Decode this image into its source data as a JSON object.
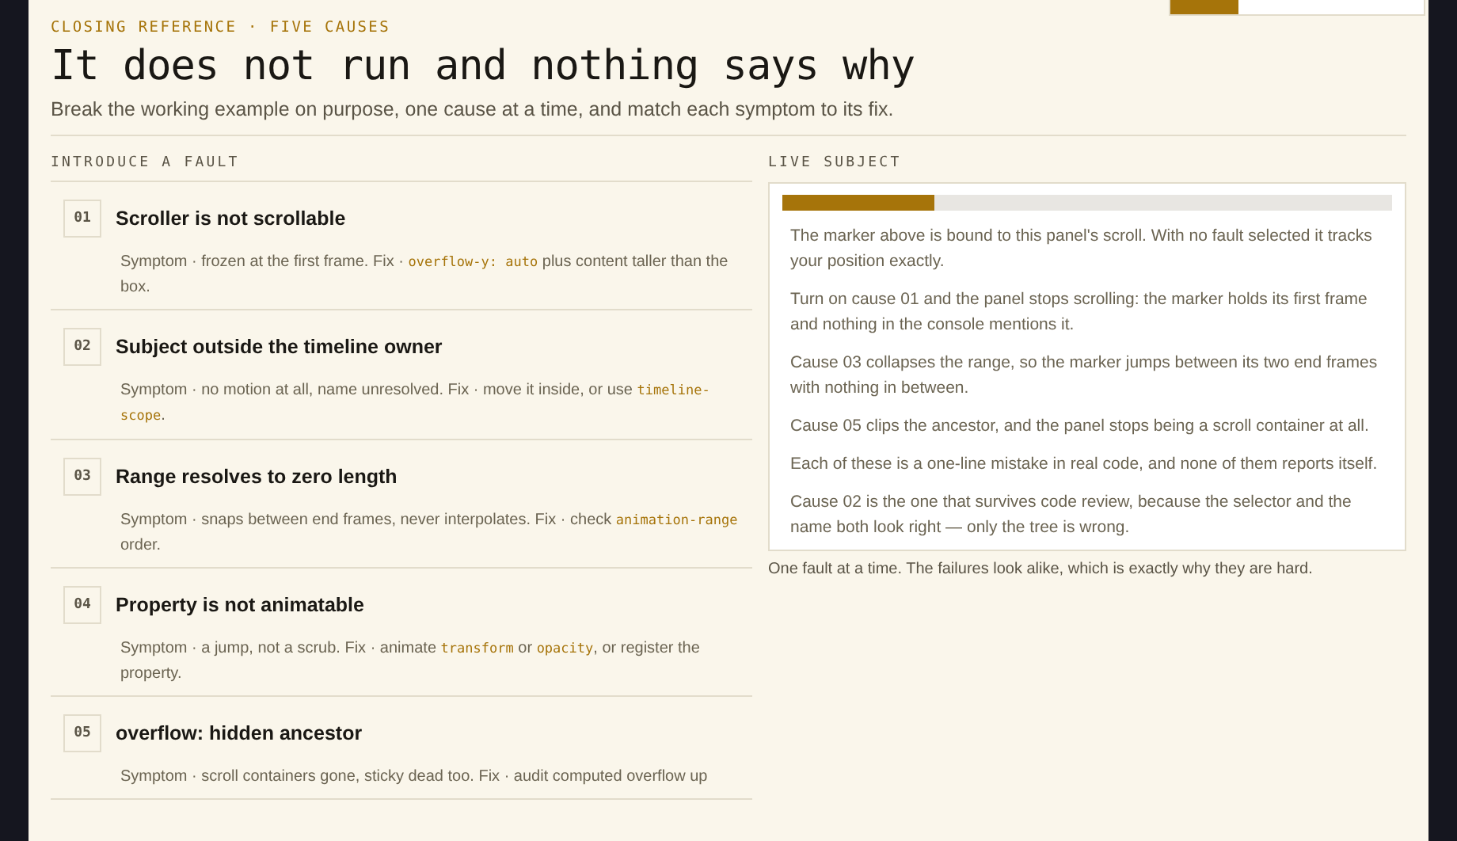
{
  "page_progress": {
    "level": 0.27
  },
  "header": {
    "eyebrow": "CLOSING REFERENCE · FIVE CAUSES",
    "title": "It does not run and nothing says why",
    "lede": "Break the working example on purpose, one cause at a time, and match each symptom to its fix."
  },
  "faults": {
    "heading": "INTRODUCE A FAULT",
    "items": [
      {
        "number": "01",
        "title": "Scroller is not scrollable",
        "body": [
          {
            "kind": "text",
            "text": "Symptom · frozen at the first frame. Fix · "
          },
          {
            "kind": "code",
            "text": "overflow-y: auto"
          },
          {
            "kind": "text",
            "text": " plus content taller than the box."
          }
        ]
      },
      {
        "number": "02",
        "title": "Subject outside the timeline owner",
        "body": [
          {
            "kind": "text",
            "text": "Symptom · no motion at all, name unresolved. Fix · move it inside, or use "
          },
          {
            "kind": "code",
            "text": "timeline-scope"
          },
          {
            "kind": "text",
            "text": "."
          }
        ]
      },
      {
        "number": "03",
        "title": "Range resolves to zero length",
        "body": [
          {
            "kind": "text",
            "text": "Symptom · snaps between end frames, never interpolates. Fix · check "
          },
          {
            "kind": "code",
            "text": "animation-range"
          },
          {
            "kind": "text",
            "text": " order."
          }
        ]
      },
      {
        "number": "04",
        "title": "Property is not animatable",
        "body": [
          {
            "kind": "text",
            "text": "Symptom · a jump, not a scrub. Fix · animate "
          },
          {
            "kind": "code",
            "text": "transform"
          },
          {
            "kind": "text",
            "text": " or "
          },
          {
            "kind": "code",
            "text": "opacity"
          },
          {
            "kind": "text",
            "text": ", or register the property."
          }
        ]
      },
      {
        "number": "05",
        "title": "overflow: hidden ancestor",
        "body": [
          {
            "kind": "text",
            "text": "Symptom · scroll containers gone, sticky dead too. Fix · audit computed overflow up"
          }
        ]
      }
    ]
  },
  "live_subject": {
    "heading": "LIVE SUBJECT",
    "marker": {
      "level": 0.25
    },
    "paragraphs": [
      "The marker above is bound to this panel's scroll. With no fault selected it tracks your position exactly.",
      "Turn on cause 01 and the panel stops scrolling: the marker holds its first frame and nothing in the console mentions it.",
      "Cause 03 collapses the range, so the marker jumps between its two end frames with nothing in between.",
      "Cause 05 clips the ancestor, and the panel stops being a scroll container at all.",
      "Each of these is a one-line mistake in real code, and none of them reports itself.",
      "Cause 02 is the one that survives code review, because the selector and the name both look right — only the tree is wrong."
    ],
    "caption": "One fault at a time. The failures look alike, which is exactly why they are hard."
  }
}
